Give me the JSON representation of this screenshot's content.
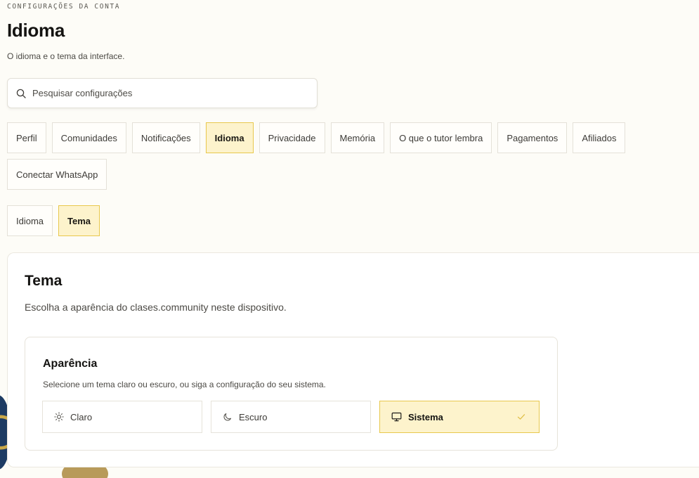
{
  "header": {
    "eyebrow": "CONFIGURAÇÕES DA CONTA",
    "title": "Idioma",
    "subtitle": "O idioma e o tema da interface."
  },
  "search": {
    "placeholder": "Pesquisar configurações",
    "value": "",
    "icon": "search-icon"
  },
  "tabs": [
    {
      "label": "Perfil",
      "active": false
    },
    {
      "label": "Comunidades",
      "active": false
    },
    {
      "label": "Notificações",
      "active": false
    },
    {
      "label": "Idioma",
      "active": true
    },
    {
      "label": "Privacidade",
      "active": false
    },
    {
      "label": "Memória",
      "active": false
    },
    {
      "label": "O que o tutor lembra",
      "active": false
    },
    {
      "label": "Pagamentos",
      "active": false
    },
    {
      "label": "Afiliados",
      "active": false
    },
    {
      "label": "Conectar WhatsApp",
      "active": false
    }
  ],
  "subtabs": [
    {
      "label": "Idioma",
      "active": false
    },
    {
      "label": "Tema",
      "active": true
    }
  ],
  "theme_card": {
    "title": "Tema",
    "description": "Escolha a aparência do clases.community neste dispositivo.",
    "appearance": {
      "title": "Aparência",
      "description": "Selecione um tema claro ou escuro, ou siga a configuração do seu sistema.",
      "options": [
        {
          "label": "Claro",
          "icon": "sun-icon",
          "selected": false
        },
        {
          "label": "Escuro",
          "icon": "moon-icon",
          "selected": false
        },
        {
          "label": "Sistema",
          "icon": "monitor-icon",
          "selected": true
        }
      ]
    }
  },
  "colors": {
    "background": "#fdfcf7",
    "accent_fill": "#fdf3cc",
    "accent_border": "#e8c84d",
    "check": "#e0c04a"
  }
}
